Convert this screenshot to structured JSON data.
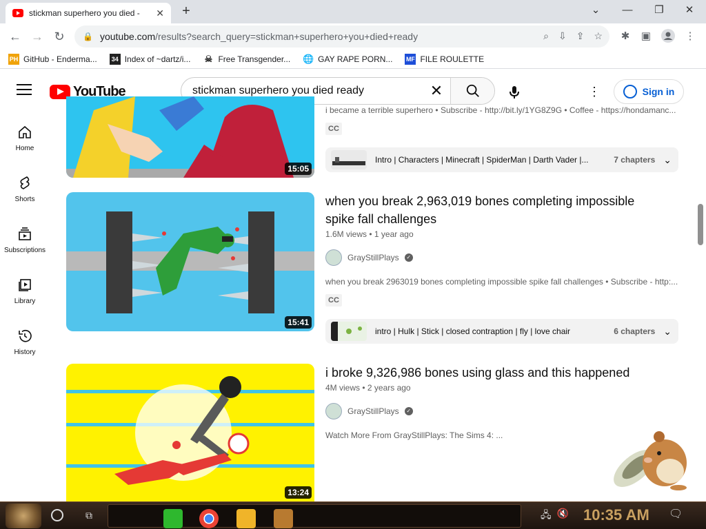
{
  "browser": {
    "tab_title": "stickman superhero you died - ",
    "url_host": "youtube.com",
    "url_path": "/results?search_query=stickman+superhero+you+died+ready",
    "bookmarks": [
      {
        "label": "GitHub - Enderma...",
        "icon": "PH"
      },
      {
        "label": "Index of ~dartz/i...",
        "icon": "34"
      },
      {
        "label": "Free Transgender...",
        "icon": "skull"
      },
      {
        "label": "GAY RAPE PORN...",
        "icon": "globe"
      },
      {
        "label": "FILE ROULETTE",
        "icon": "MF"
      }
    ]
  },
  "youtube": {
    "logo_text": "YouTube",
    "search_value": "stickman superhero you died ready",
    "signin_label": "Sign in",
    "sidebar": [
      {
        "label": "Home",
        "icon": "home-icon"
      },
      {
        "label": "Shorts",
        "icon": "shorts-icon"
      },
      {
        "label": "Subscriptions",
        "icon": "subscriptions-icon"
      },
      {
        "label": "Library",
        "icon": "library-icon"
      },
      {
        "label": "History",
        "icon": "history-icon"
      }
    ],
    "results": [
      {
        "duration": "15:05",
        "snippet": "i became a terrible superhero • Subscribe - http://bit.ly/1YG8Z9G • Coffee - https://hondamanc...",
        "cc": "CC",
        "chapters_list": "Intro | Characters | Minecraft | SpiderMan | Darth Vader |...",
        "chapters_count": "7 chapters"
      },
      {
        "title": "when you break 2,963,019 bones completing impossible spike fall challenges",
        "views": "1.6M views",
        "age": "1 year ago",
        "channel": "GrayStillPlays",
        "duration": "15:41",
        "snippet": "when you break 2963019 bones completing impossible spike fall challenges • Subscribe - http:...",
        "cc": "CC",
        "chapters_list": "intro | Hulk | Stick | closed contraption | fly | love chair",
        "chapters_count": "6 chapters"
      },
      {
        "title": "i broke 9,326,986 bones using glass and this happened",
        "views": "4M views",
        "age": "2 years ago",
        "channel": "GrayStillPlays",
        "duration": "13:24",
        "snippet": "Watch More From GrayStillPlays: The Sims 4: ..."
      }
    ]
  },
  "taskbar": {
    "clock": "10:35 AM"
  },
  "colors": {
    "yt_red": "#ff0000",
    "link_blue": "#065fd4",
    "taskbar_brown": "#2a1d14",
    "clock_gold": "#c9a060"
  }
}
